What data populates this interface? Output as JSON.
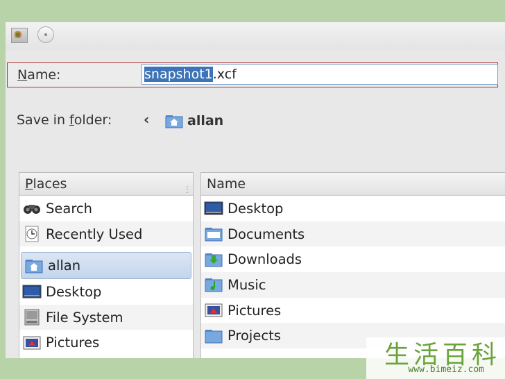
{
  "dialog": {
    "name_label_underlined": "N",
    "name_label_rest": "ame:",
    "filename_selected": "snapshot1",
    "filename_extension": ".xcf",
    "save_in_prefix": "Save in ",
    "save_in_underlined": "f",
    "save_in_rest": "older:",
    "current_folder": "allan",
    "back_glyph": "‹"
  },
  "places": {
    "header_underlined": "P",
    "header_rest": "laces",
    "items": [
      {
        "label": "Search",
        "icon": "binoculars-icon"
      },
      {
        "label": "Recently Used",
        "icon": "clock-icon"
      },
      {
        "label": "allan",
        "icon": "home-folder-icon"
      },
      {
        "label": "Desktop",
        "icon": "desktop-icon"
      },
      {
        "label": "File System",
        "icon": "drive-icon"
      },
      {
        "label": "Pictures",
        "icon": "pictures-icon"
      }
    ]
  },
  "files": {
    "header": "Name",
    "items": [
      {
        "label": "Desktop",
        "icon": "desktop-icon"
      },
      {
        "label": "Documents",
        "icon": "folder-icon"
      },
      {
        "label": "Downloads",
        "icon": "download-folder-icon"
      },
      {
        "label": "Music",
        "icon": "music-folder-icon"
      },
      {
        "label": "Pictures",
        "icon": "pictures-icon"
      },
      {
        "label": "Projects",
        "icon": "folder-icon"
      }
    ]
  },
  "watermark": {
    "chars": "生活百科",
    "url": "www.bimeiz.com"
  },
  "colors": {
    "selection": "#3d73b8",
    "background": "#b9d3a8",
    "watermark": "#6aa33a"
  }
}
